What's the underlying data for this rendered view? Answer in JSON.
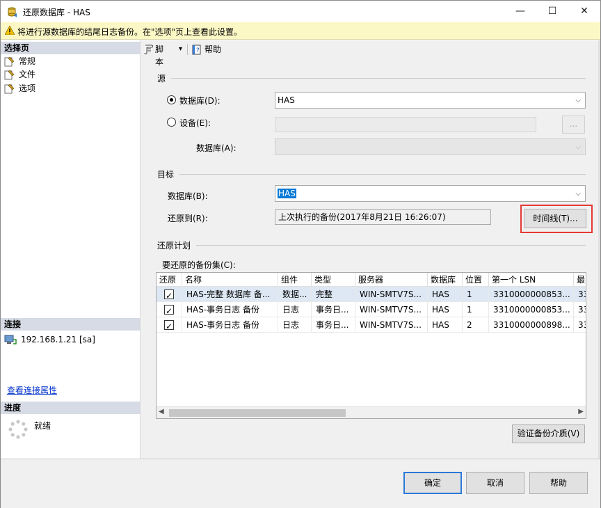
{
  "window": {
    "title": "还原数据库 - HAS",
    "minimize": "—",
    "maximize": "☐",
    "close": "✕"
  },
  "warning": {
    "text": "将进行源数据库的结尾日志备份。在\"选项\"页上查看此设置。"
  },
  "left": {
    "select_page_header": "选择页",
    "pages": [
      {
        "label": "常规"
      },
      {
        "label": "文件"
      },
      {
        "label": "选项"
      }
    ],
    "connection_header": "连接",
    "connection": "192.168.1.21 [sa]",
    "view_props_link": "查看连接属性",
    "progress_header": "进度",
    "progress_status": "就绪"
  },
  "toolbar": {
    "script_label": "脚本",
    "dropdown": "▾",
    "help_label": "帮助"
  },
  "source": {
    "group_label": "源",
    "database_radio_label": "数据库(D):",
    "database_value": "HAS",
    "device_radio_label": "设备(E):",
    "device_value": "",
    "browse_label": "...",
    "device_db_label": "数据库(A):",
    "device_db_value": ""
  },
  "destination": {
    "group_label": "目标",
    "database_label": "数据库(B):",
    "database_value": "HAS",
    "restore_to_label": "还原到(R):",
    "restore_to_value": "上次执行的备份(2017年8月21日 16:26:07)",
    "timeline_button": "时间线(T)..."
  },
  "plan": {
    "group_label": "还原计划",
    "backup_sets_label": "要还原的备份集(C):",
    "columns": [
      "还原",
      "名称",
      "组件",
      "类型",
      "服务器",
      "数据库",
      "位置",
      "第一个 LSN",
      "最"
    ],
    "rows": [
      {
        "name": "HAS-完整 数据库 备...",
        "component": "数据...",
        "type": "完整",
        "server": "WIN-SMTV7S...",
        "database": "HAS",
        "position": "1",
        "first_lsn": "3310000000853...",
        "last": "33"
      },
      {
        "name": "HAS-事务日志  备份",
        "component": "日志",
        "type": "事务日...",
        "server": "WIN-SMTV7S...",
        "database": "HAS",
        "position": "1",
        "first_lsn": "3310000000853...",
        "last": "33"
      },
      {
        "name": "HAS-事务日志  备份",
        "component": "日志",
        "type": "事务日...",
        "server": "WIN-SMTV7S...",
        "database": "HAS",
        "position": "2",
        "first_lsn": "3310000000898...",
        "last": "33"
      }
    ],
    "verify_button": "验证备份介质(V)"
  },
  "buttons": {
    "ok": "确定",
    "cancel": "取消",
    "help": "帮助"
  },
  "colors": {
    "accent": "#2b79d8",
    "highlight": "#e53935",
    "section_header": "#d6dbe6",
    "warning_bg": "#fcf8c6"
  }
}
